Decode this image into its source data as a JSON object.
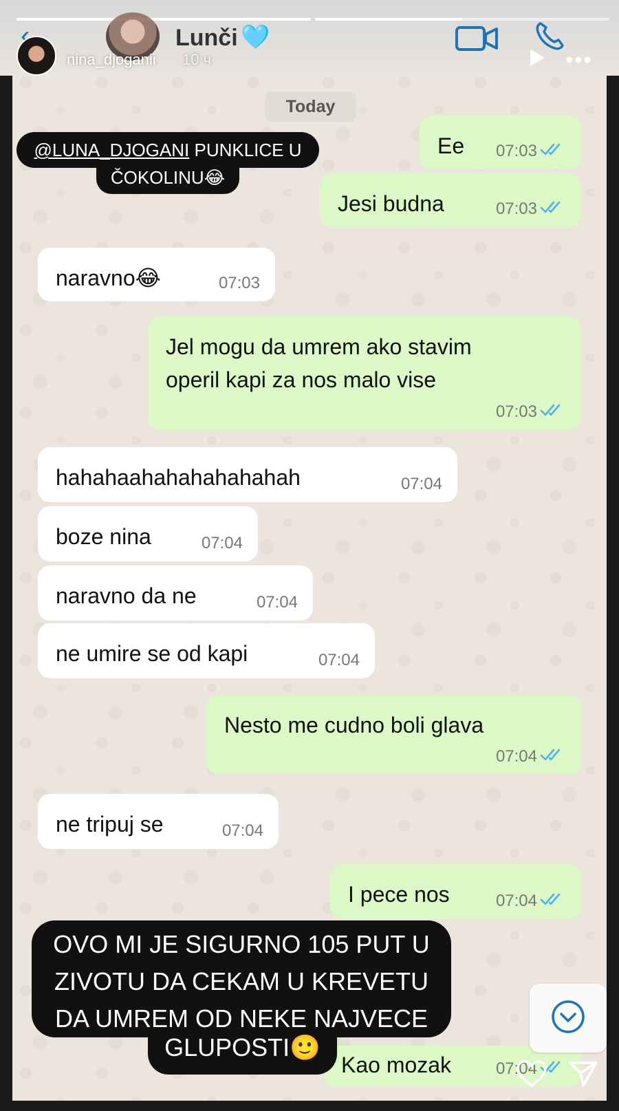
{
  "story": {
    "username": "nina_djoganii",
    "time_ago": "10 ч",
    "progress": [
      1.0,
      0.5
    ],
    "sticker_top_mention": "@LUNA_DJOGANI",
    "sticker_top_rest": " PUNKLICE U",
    "sticker_top_line2": "ČOKOLINU😂",
    "sticker_bottom": "OVO MI JE SIGURNO 105 PUT U\nZIVOTU DA CEKAM U KREVETU\nDA UMREM OD NEKE NAJVECE",
    "sticker_bottom_line4": "GLUPOSTI🙂"
  },
  "chat_header": {
    "contact_name": "Lunči",
    "heart": "🩵",
    "icons": [
      "back-arrow-icon",
      "video-call-icon",
      "phone-icon"
    ]
  },
  "date_chip": "Today",
  "messages": [
    {
      "dir": "out",
      "text": "Ee",
      "time": "07:03"
    },
    {
      "dir": "out",
      "text": "Jesi budna",
      "time": "07:03"
    },
    {
      "dir": "in",
      "text": "naravno😂",
      "time": "07:03"
    },
    {
      "dir": "out",
      "text": "Jel mogu da umrem ako stavim\noperil kapi za nos malo vise",
      "time": "07:03"
    },
    {
      "dir": "in",
      "text": "hahahaahahahahahahah",
      "time": "07:04"
    },
    {
      "dir": "in",
      "text": "boze nina",
      "time": "07:04"
    },
    {
      "dir": "in",
      "text": "naravno da ne",
      "time": "07:04"
    },
    {
      "dir": "in",
      "text": "ne umire se od kapi",
      "time": "07:04"
    },
    {
      "dir": "out",
      "text": "Nesto me cudno boli glava",
      "time": "07:04"
    },
    {
      "dir": "in",
      "text": "ne tripuj se",
      "time": "07:04"
    },
    {
      "dir": "out",
      "text": "I pece nos",
      "time": "07:04"
    },
    {
      "dir": "out",
      "text": "Kao mozak",
      "time": "07:04"
    }
  ],
  "colors": {
    "outgoing_bubble": "#dcf8c6",
    "incoming_bubble": "#ffffff",
    "read_ticks": "#4fb3e8",
    "accent": "#1f73b7"
  }
}
